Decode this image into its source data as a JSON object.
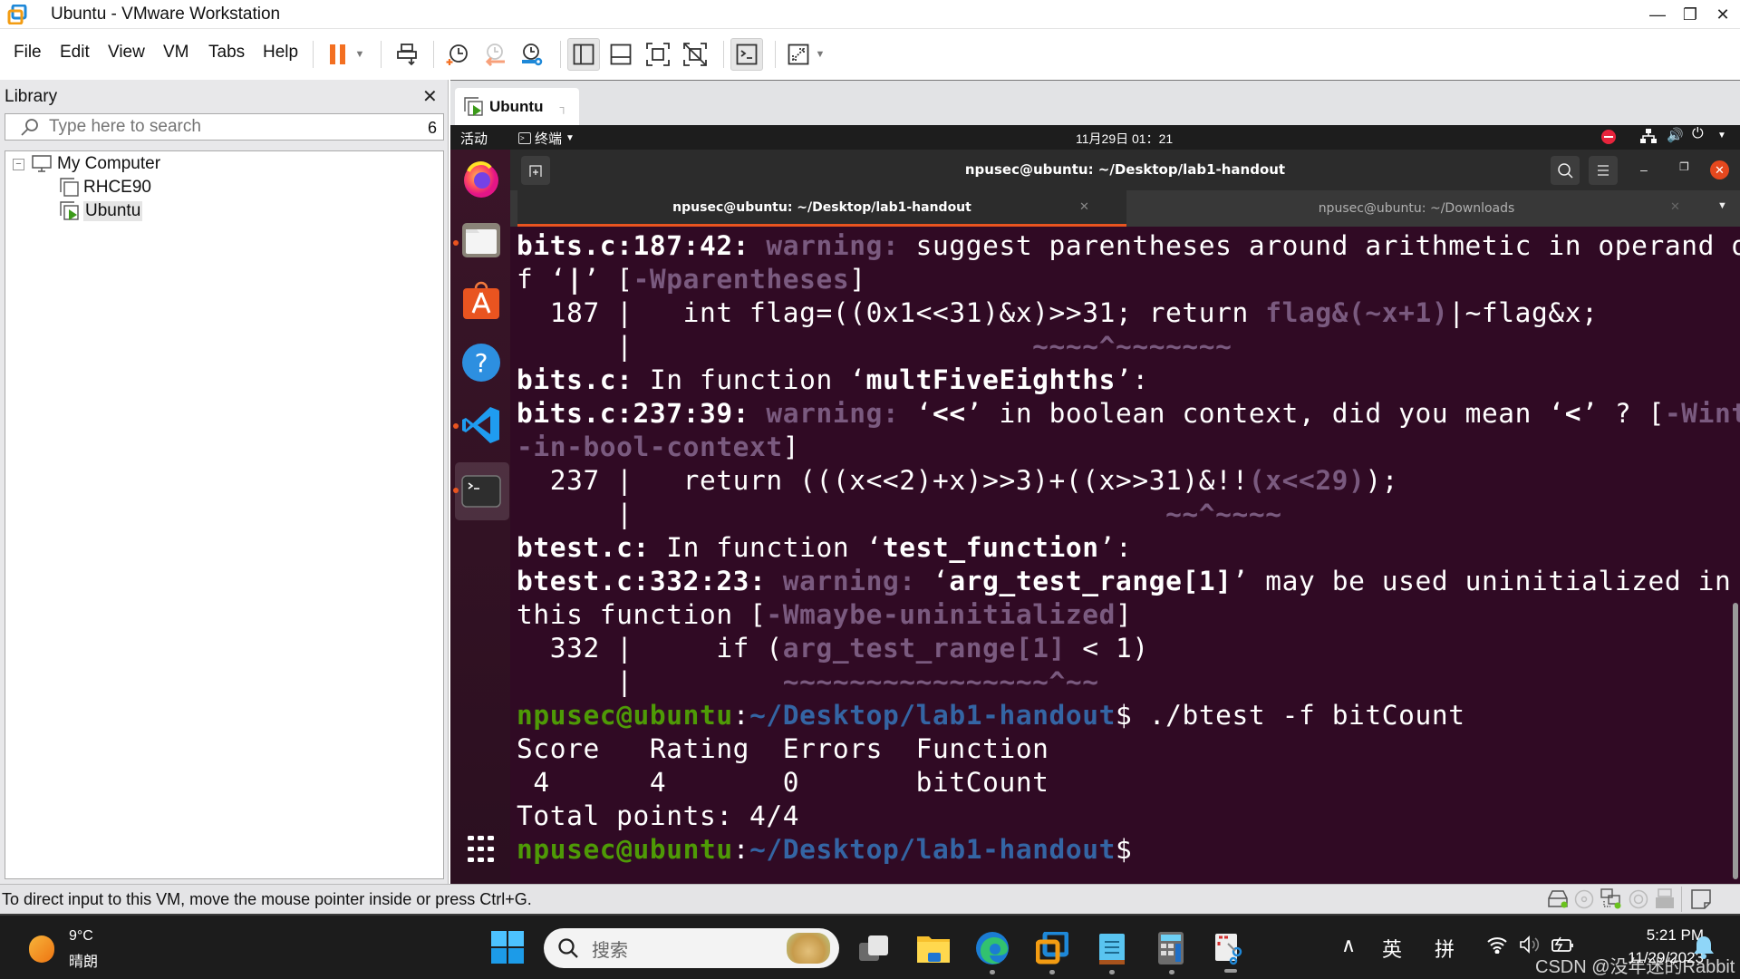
{
  "window": {
    "title": "Ubuntu - VMware Workstation",
    "controls": [
      "minimize",
      "restore",
      "close"
    ]
  },
  "menu": [
    "File",
    "Edit",
    "View",
    "VM",
    "Tabs",
    "Help"
  ],
  "toolbar": {
    "buttons": [
      "pause-vm",
      "pause-dropdown",
      "send-ctrl-alt-del",
      "take-snapshot",
      "revert-snapshot",
      "manage-snapshots",
      "show-library",
      "show-thumbnail-bar",
      "full-screen",
      "unity",
      "console-view",
      "stretch-guest",
      "stretch-dropdown"
    ]
  },
  "library": {
    "title": "Library",
    "search_placeholder": "Type here to search",
    "search_count": "6",
    "tree": {
      "root": "My Computer",
      "children": [
        {
          "label": "RHCE90",
          "running": false
        },
        {
          "label": "Ubuntu",
          "running": true,
          "selected": true
        }
      ]
    }
  },
  "vm_tab": {
    "label": "Ubuntu"
  },
  "ubuntu": {
    "activities": "活动",
    "app_menu": "终端",
    "clock": "11月29日 01：21",
    "dock": [
      "firefox",
      "files",
      "software",
      "help",
      "vscode",
      "terminal",
      "show-apps"
    ]
  },
  "terminal": {
    "title": "npusec@ubuntu: ~/Desktop/lab1-handout",
    "tabs": [
      {
        "label": "npusec@ubuntu: ~/Desktop/lab1-handout",
        "active": true
      },
      {
        "label": "npusec@ubuntu: ~/Downloads",
        "active": false
      }
    ],
    "lines": {
      "l1a": "bits.c:187:42:",
      "l1b": " warning:",
      "l1c": " suggest parentheses around arithmetic in operand o",
      "l2a": "f ‘",
      "l2b": "|",
      "l2c": "’ [",
      "l2d": "-Wparentheses",
      "l2e": "]",
      "l3a": "  187 |   int flag=((0x1<<31)&x)>>31; return ",
      "l3b": "flag&(~x+1)",
      "l3c": "|~flag&x;",
      "l4a": "      |",
      "l4b": "                        ~~~~^~~~~~~~",
      "l5a": "bits.c:",
      "l5b": " In function ‘",
      "l5c": "multFiveEighths",
      "l5d": "’:",
      "l6a": "bits.c:237:39:",
      "l6b": " warning:",
      "l6c": " ‘",
      "l6d": "<<",
      "l6e": "’ in boolean context, did you mean ‘",
      "l6f": "<",
      "l6g": "’ ? [",
      "l6h": "-Wint",
      "l7a": "-in-bool-context",
      "l7b": "]",
      "l8a": "  237 |   return (((x<<2)+x)>>3)+((x>>31)&!!",
      "l8b": "(x<<29)",
      "l8c": ");",
      "l9a": "      |",
      "l9b": "                                ~~^~~~~",
      "l10a": "btest.c:",
      "l10b": " In function ‘",
      "l10c": "test_function",
      "l10d": "’:",
      "l11a": "btest.c:332:23:",
      "l11b": " warning:",
      "l11c": " ‘",
      "l11d": "arg_test_range[1]",
      "l11e": "’ may be used uninitialized in",
      "l12a": "this function [",
      "l12b": "-Wmaybe-uninitialized",
      "l12c": "]",
      "l13a": "  332 |     if (",
      "l13b": "arg_test_range[1]",
      "l13c": " < 1)",
      "l14a": "      |",
      "l14b": "         ~~~~~~~~~~~~~~~~^~~",
      "prompt_user": "npusec@ubuntu",
      "prompt_colon": ":",
      "prompt_path": "~/Desktop/lab1-handout",
      "prompt_dollar": "$",
      "command": " ./btest -f bitCount",
      "table_header": "Score   Rating  Errors  Function",
      "table_row": " 4      4       0       bitCount",
      "total": "Total points: 4/4"
    }
  },
  "statusbar": {
    "message": "To direct input to this VM, move the mouse pointer inside or press Ctrl+G.",
    "devices": [
      "hard-disk",
      "cd-dvd",
      "network-adapter",
      "sound-card",
      "usb-printer",
      "message-log"
    ]
  },
  "taskbar": {
    "weather_temp": "9°C",
    "weather_desc": "晴朗",
    "search_placeholder": "搜索",
    "apps": [
      "task-view",
      "file-explorer",
      "edge",
      "vmware",
      "notepad",
      "calculator",
      "snipping-tool"
    ],
    "tray_input_lang": "英",
    "tray_ime": "拼",
    "time": "5:21 PM",
    "date": "11/29/2023",
    "watermark": "CSDN @没年迷的Rabbit"
  }
}
